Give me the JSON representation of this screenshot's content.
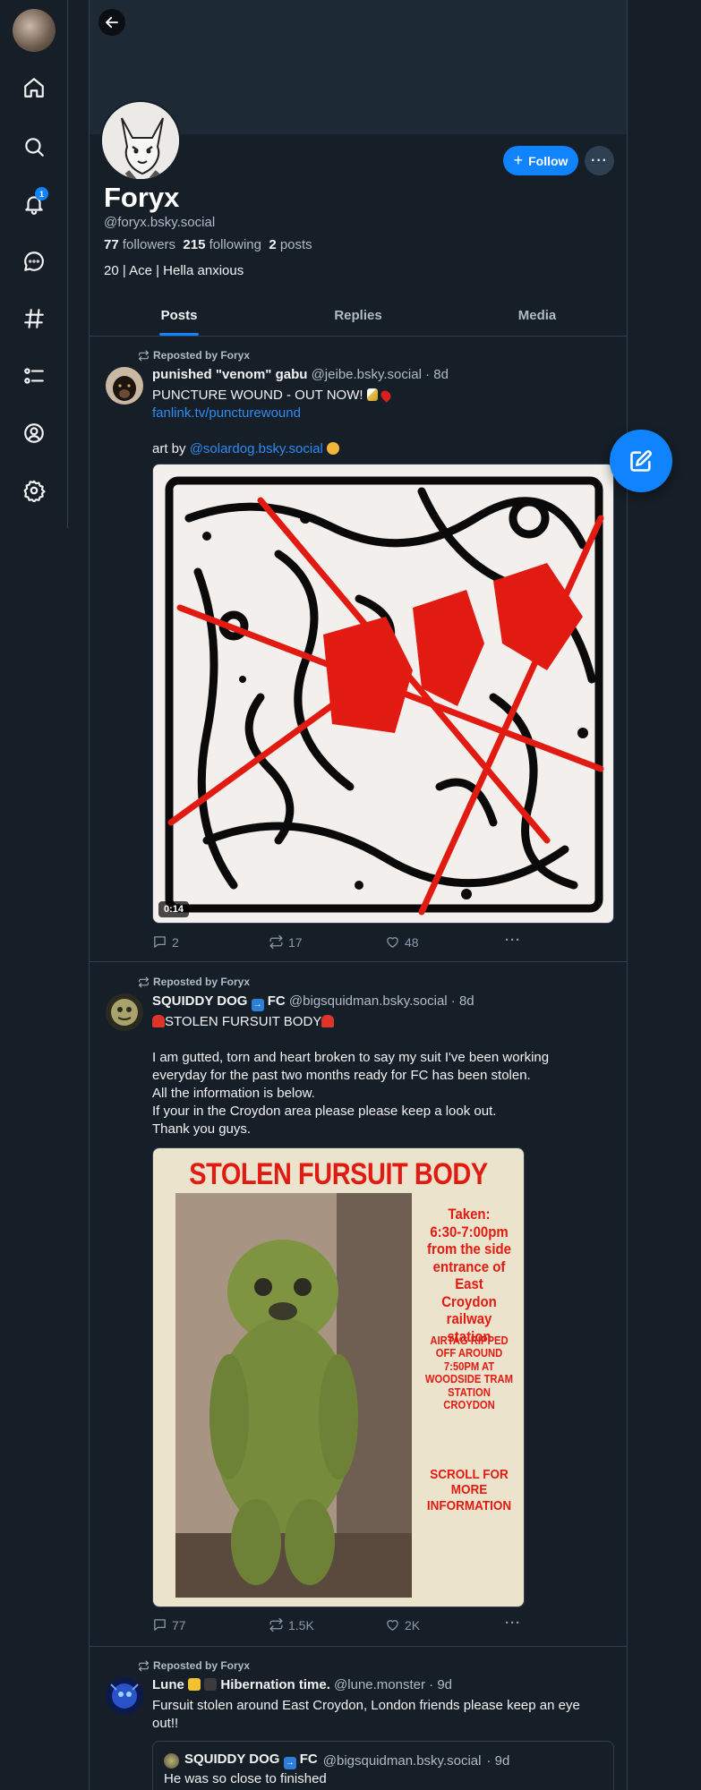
{
  "nav": {
    "items": [
      "home",
      "search",
      "notifications",
      "chat",
      "feeds",
      "lists",
      "profile",
      "settings"
    ],
    "notification_badge": "1"
  },
  "profile": {
    "display_name": "Foryx",
    "handle": "@foryx.bsky.social",
    "followers_count": "77",
    "followers_label": "followers",
    "following_count": "215",
    "following_label": "following",
    "posts_count": "2",
    "posts_label": "posts",
    "bio": "20 | Ace | Hella anxious",
    "follow_label": "Follow",
    "more_label": "···"
  },
  "tabs": [
    {
      "label": "Posts",
      "active": true
    },
    {
      "label": "Replies",
      "active": false
    },
    {
      "label": "Media",
      "active": false
    }
  ],
  "posts": [
    {
      "repost_by": "Reposted by Foryx",
      "author_name": "punished \"venom\" gabu",
      "author_handle": "@jeibe.bsky.social",
      "time": "· 8d",
      "text_line1": "PUNCTURE WOUND - OUT NOW!",
      "link": "fanlink.tv/puncturewound",
      "text_art": "art by ",
      "mention": "@solardog.bsky.social",
      "video_duration": "0:14",
      "replies": "2",
      "reposts": "17",
      "likes": "48"
    },
    {
      "repost_by": "Reposted by Foryx",
      "author_name": "SQUIDDY DOG",
      "author_name_suffix": "FC",
      "author_handle": "@bigsquidman.bsky.social",
      "time": "· 8d",
      "headline": "STOLEN FURSUIT BODY",
      "body": [
        "I am gutted, torn and heart broken to say my suit I've been working",
        "everyday for the past two months ready for FC has been stolen.",
        "All the information is below.",
        "If your in the Croydon area please please keep a look out.",
        "Thank you guys."
      ],
      "poster": {
        "title": "STOLEN FURSUIT BODY",
        "taken": [
          "Taken:",
          "6:30-7:00pm",
          "from the side",
          "entrance of East",
          "Croydon railway",
          "station"
        ],
        "airtag": [
          "AIRTAG RIPPED",
          "OFF AROUND",
          "7:50PM AT",
          "WOODSIDE TRAM",
          "STATION",
          "CROYDON"
        ],
        "scroll": [
          "SCROLL FOR",
          "MORE",
          "INFORMATION"
        ]
      },
      "replies": "77",
      "reposts": "1.5K",
      "likes": "2K"
    },
    {
      "repost_by": "Reposted by Foryx",
      "author_name": "Lune",
      "author_name_suffix": "Hibernation time.",
      "author_handle": "@lune.monster",
      "time": "· 9d",
      "text": [
        "Fursuit stolen around East Croydon, London friends please keep an eye",
        "out!!"
      ],
      "quote": {
        "author_name": "SQUIDDY DOG",
        "author_name_suffix": "FC",
        "author_handle": "@bigsquidman.bsky.social",
        "time": "· 9d",
        "text": "He was so close to finished"
      }
    }
  ],
  "colors": {
    "accent": "#1083fe",
    "background": "#161e27",
    "poster_red": "#e21b12"
  }
}
